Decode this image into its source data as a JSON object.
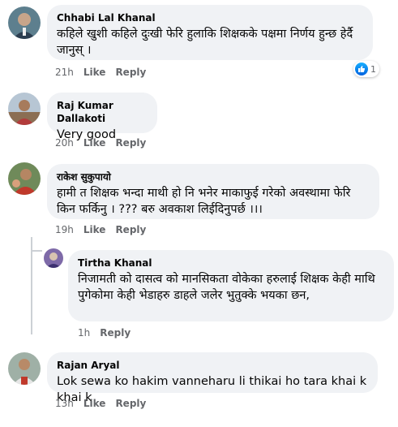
{
  "comments": [
    {
      "author": "Chhabi Lal Khanal",
      "text": "कहिले खुशी कहिले दुःखी फेरि हुलाकि शिक्षकके पक्षमा निर्णय हुन्छ हेर्दै जानुस् ।",
      "time": "21h",
      "like_label": "Like",
      "reply_label": "Reply",
      "reaction_count": "1"
    },
    {
      "author": "Raj Kumar Dallakoti",
      "text": "Very good",
      "time": "20h",
      "like_label": "Like",
      "reply_label": "Reply"
    },
    {
      "author": "राकेश सुकुपायो",
      "text": "हामी त शिक्षक भन्दा माथी हो नि भनेर माकाफुई गरेको अवस्थामा फेरि किन फर्किनु । ??? बरु अवकाश लिईदिनुपर्छ ।।।",
      "time": "19h",
      "like_label": "Like",
      "reply_label": "Reply"
    },
    {
      "author": "Tirtha Khanal",
      "text": "निजामती को दासत्व  को मानसिकता वोकेका हरुलाई शिक्षक केही माथि पुगेकोमा केही भेडाहरु डाहले जलेर भुतुक्के भयका छन,",
      "time": "1h",
      "reply_label": "Reply"
    },
    {
      "author": "Rajan Aryal",
      "text": "Lok sewa ko hakim vanneharu li thikai ho tara khai k khai k",
      "time": "13h",
      "like_label": "Like",
      "reply_label": "Reply"
    }
  ],
  "colors": {
    "bubble": "#f0f2f5",
    "meta": "#65676b",
    "text": "#050505",
    "like_blue": "#1877f2"
  }
}
